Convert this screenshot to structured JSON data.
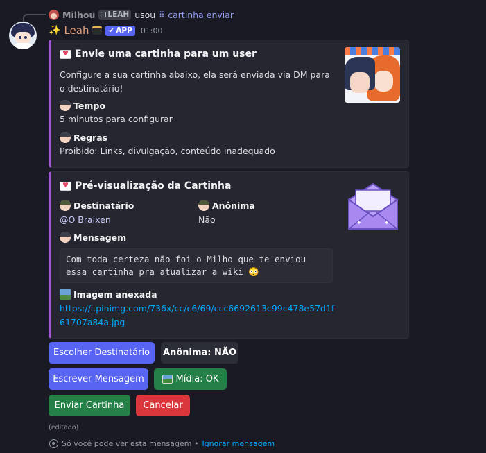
{
  "reply": {
    "username": "Milhou",
    "clan_tag": "LEAH",
    "used_text": "usou",
    "command": "cartinha enviar"
  },
  "message": {
    "author": "Leah",
    "app_badge": "APP",
    "timestamp": "01:00",
    "edited_label": "(editado)"
  },
  "embed1": {
    "title": "Envie uma cartinha para um user",
    "description": "Configure a sua cartinha abaixo, ela será enviada via DM para o destinatário!",
    "fields": [
      {
        "name": "Tempo",
        "value": "5 minutos para configurar"
      },
      {
        "name": "Regras",
        "value": "Proibido: Links, divulgação, conteúdo inadequado"
      }
    ],
    "accent_color": "#9b59d0"
  },
  "embed2": {
    "title": "Pré-visualização da Cartinha",
    "recipient": {
      "name": "Destinatário",
      "value": "@O Braixen"
    },
    "anonymous": {
      "name": "Anônima",
      "value": "Não"
    },
    "message": {
      "name": "Mensagem",
      "value": "Com toda certeza não foi o Milho que te enviou essa cartinha pra atualizar a wiki 😳"
    },
    "image": {
      "name": "Imagem anexada",
      "value": "https://i.pinimg.com/736x/cc/c6/69/ccc6692613c99c478e57d1f61707a84a.jpg"
    }
  },
  "buttons": {
    "choose_recipient": "Escolher Destinatário",
    "anonymous": "Anônima: NÃO",
    "write_message": "Escrever Mensagem",
    "media": "Mídia: OK",
    "send": "Enviar Cartinha",
    "cancel": "Cancelar"
  },
  "footer": {
    "ephemeral_text": "Só você pode ver esta mensagem •",
    "dismiss_text": "Ignorar mensagem"
  },
  "colors": {
    "primary": "#5865f2",
    "success": "#248046",
    "danger": "#da373c",
    "embed_accent": "#9b59d0"
  }
}
